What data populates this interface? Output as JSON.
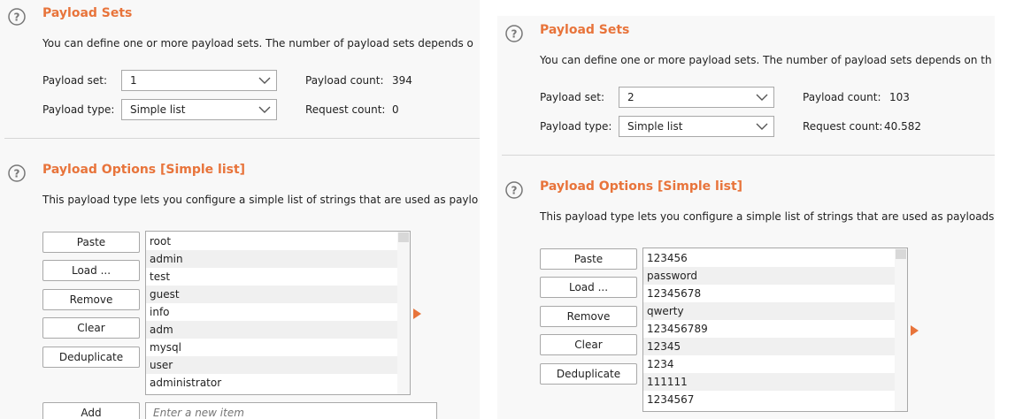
{
  "colors": {
    "accent": "#e8743b",
    "panel_bg": "#f8f8f8",
    "border": "#a8a8a8"
  },
  "left": {
    "payload_sets": {
      "title": "Payload Sets",
      "description": "You can define one or more payload sets. The number of payload sets depends o",
      "payload_set_label": "Payload set:",
      "payload_set_value": "1",
      "payload_count_label": "Payload count:",
      "payload_count_value": "394",
      "payload_type_label": "Payload type:",
      "payload_type_value": "Simple list",
      "request_count_label": "Request count:",
      "request_count_value": "0"
    },
    "payload_options": {
      "title": "Payload Options [Simple list]",
      "description": "This payload type lets you configure a simple list of strings that are used as paylo",
      "buttons": {
        "paste": "Paste",
        "load": "Load ...",
        "remove": "Remove",
        "clear": "Clear",
        "deduplicate": "Deduplicate",
        "add": "Add"
      },
      "items": [
        "root",
        "admin",
        "test",
        "guest",
        "info",
        "adm",
        "mysql",
        "user",
        "administrator"
      ],
      "new_item_placeholder": "Enter a new item"
    }
  },
  "right": {
    "payload_sets": {
      "title": "Payload Sets",
      "description": "You can define one or more payload sets. The number of payload sets depends on th",
      "payload_set_label": "Payload set:",
      "payload_set_value": "2",
      "payload_count_label": "Payload count:",
      "payload_count_value": "103",
      "payload_type_label": "Payload type:",
      "payload_type_value": "Simple list",
      "request_count_label": "Request count:",
      "request_count_value": "40.582"
    },
    "payload_options": {
      "title": "Payload Options [Simple list]",
      "description": "This payload type lets you configure a simple list of strings that are used as payloads",
      "buttons": {
        "paste": "Paste",
        "load": "Load ...",
        "remove": "Remove",
        "clear": "Clear",
        "deduplicate": "Deduplicate"
      },
      "items": [
        "123456",
        "password",
        "12345678",
        "qwerty",
        "123456789",
        "12345",
        "1234",
        "111111",
        "1234567"
      ]
    }
  }
}
